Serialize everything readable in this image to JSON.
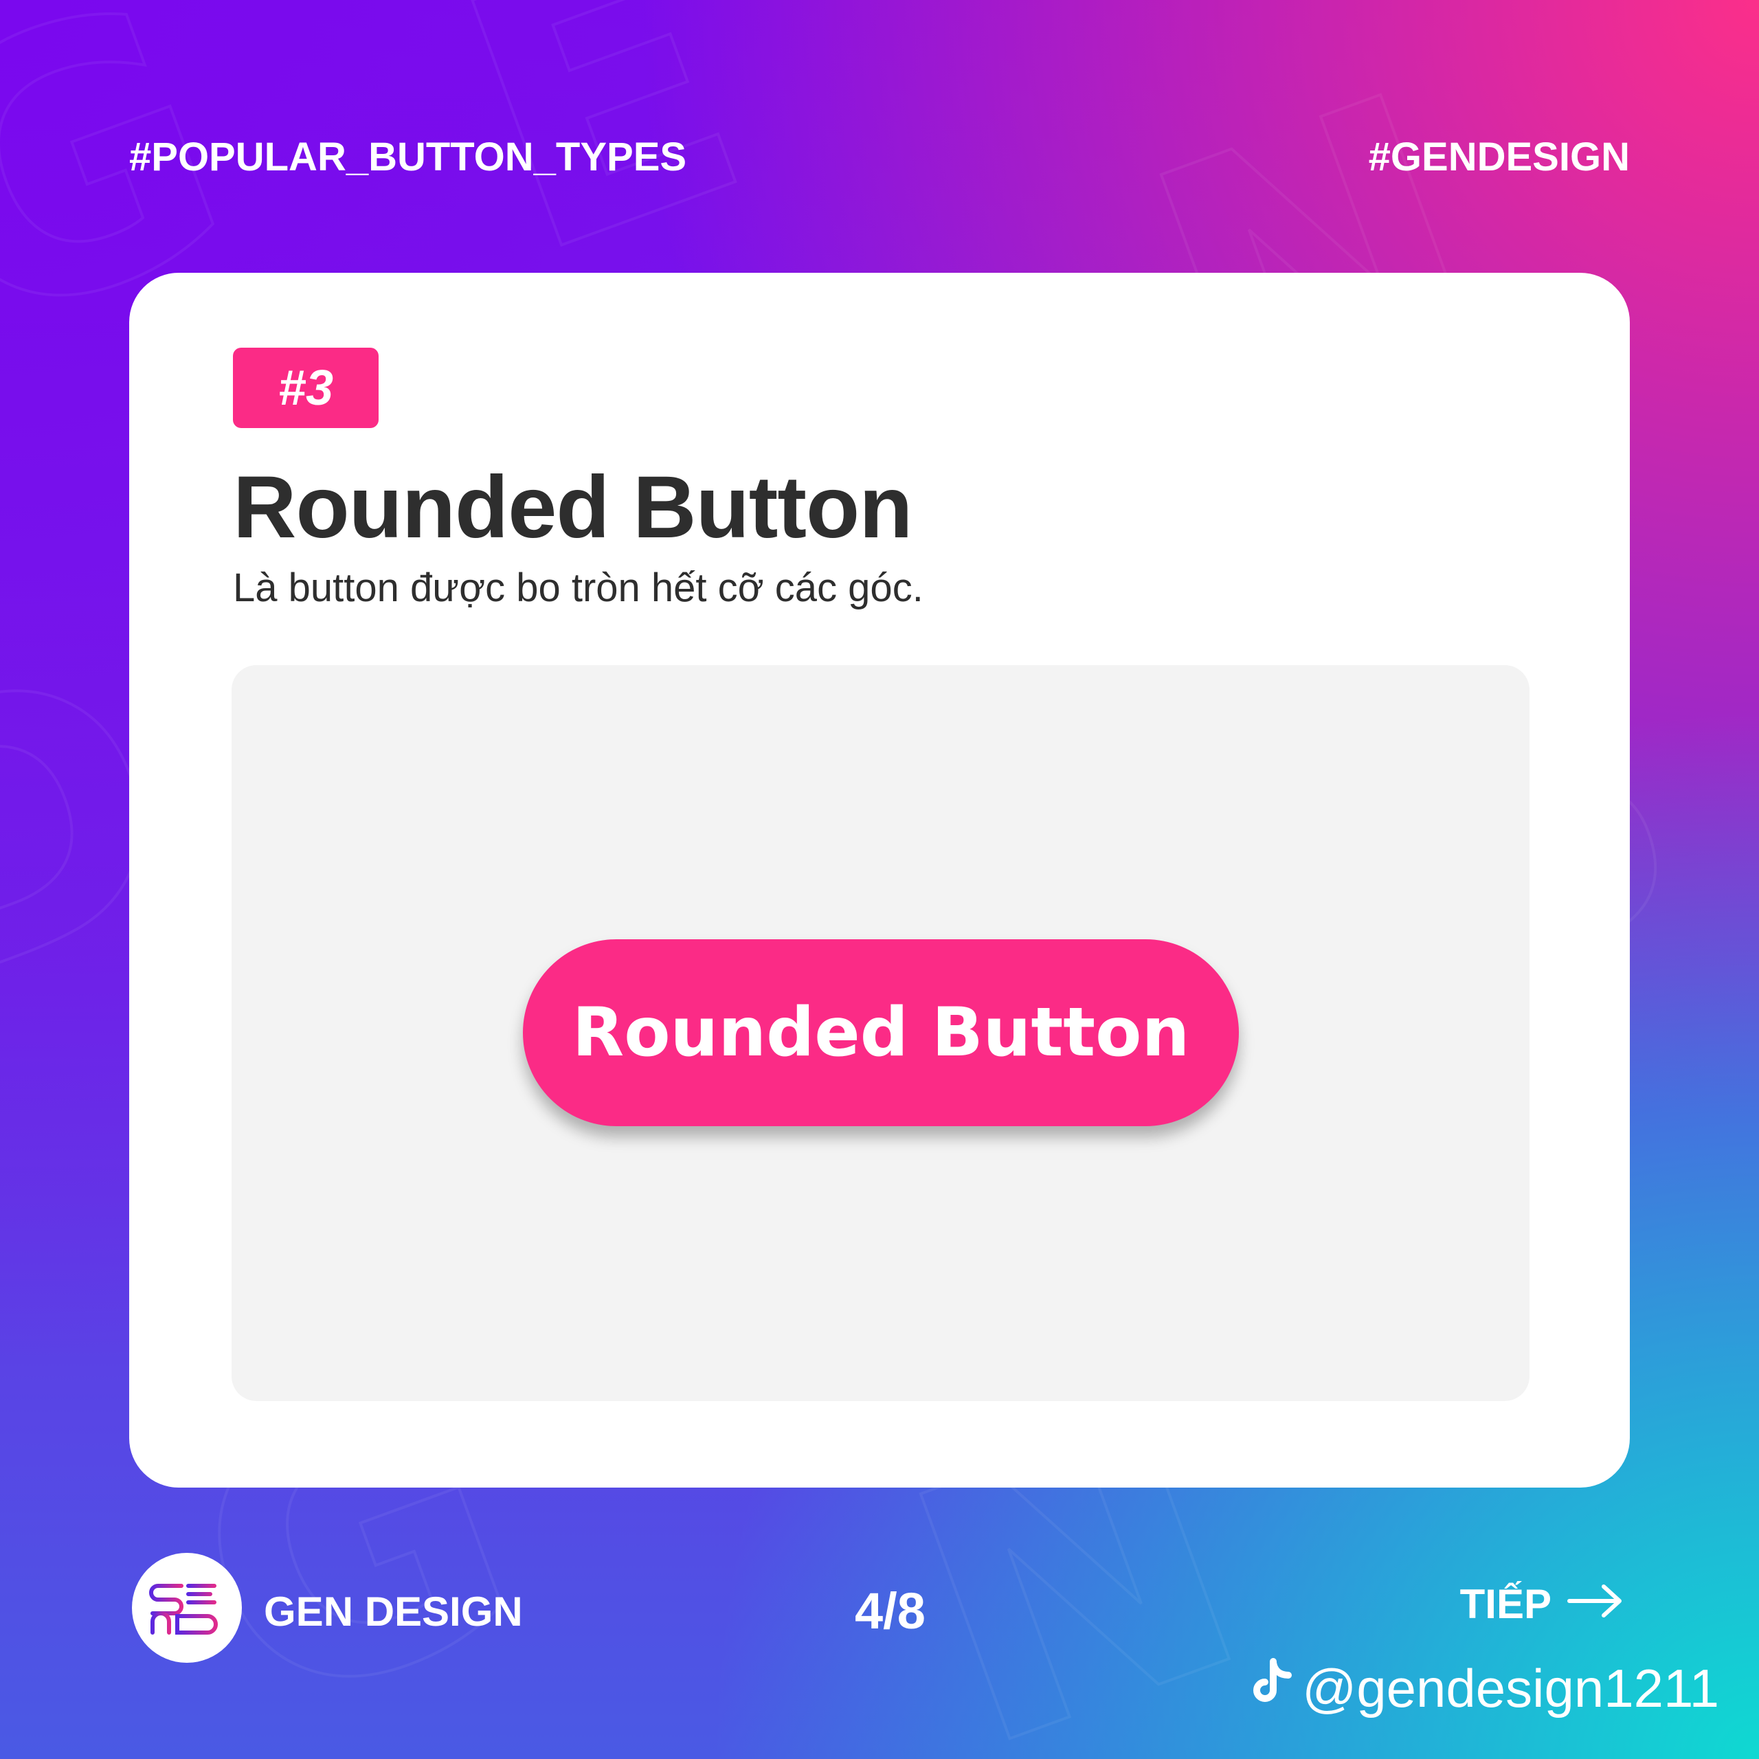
{
  "header": {
    "left_tag": "#POPULAR_BUTTON_TYPES",
    "right_tag": "#GENDESIGN"
  },
  "card": {
    "badge": "#3",
    "title": "Rounded Button",
    "description": "Là button được bo tròn hết cỡ các góc.",
    "demo_button_label": "Rounded Button"
  },
  "footer": {
    "brand_name": "GEN DESIGN",
    "page_indicator": "4/8",
    "next_label": "TIẾP",
    "social_handle": "@gendesign1211"
  },
  "icons": {
    "logo": "gen-design-logo-icon",
    "next": "arrow-right-icon",
    "social": "tiktok-icon"
  },
  "colors": {
    "accent": "#fb2b86",
    "text_dark": "#2e2e2e",
    "demo_bg": "#f3f3f3",
    "gradient_top_left": "#7a08ee",
    "gradient_top_right": "#fb2f8a",
    "gradient_bottom_right": "#0fd9d2"
  }
}
